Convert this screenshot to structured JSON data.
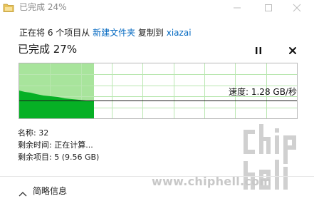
{
  "window": {
    "title": "已完成 24%"
  },
  "header": {
    "prefix": "正在将 6 个项目从 ",
    "source": "新建文件夹",
    "middle": " 复制到 ",
    "destination": "xiazai"
  },
  "progress": {
    "label": "已完成 27%",
    "fraction": 0.27
  },
  "graph": {
    "speed_label": "速度: 1.28 GB/秒"
  },
  "stats": {
    "name": "名称: 32",
    "time_remaining": "剩余时间: 正在计算...",
    "items_remaining": "剩余项目: 5 (9.56 GB)"
  },
  "footer": {
    "details_label": "简略信息"
  },
  "watermark": {
    "url": "www.chiphell.com",
    "logo_text": "chip hell"
  },
  "colors": {
    "accent": "#0067c0",
    "graph_fill": "#06b025",
    "graph_light": "#a8e49c",
    "grid": "#b9e7b0"
  },
  "icons": {
    "app": "folder-copy-icon",
    "pause": "pause-icon",
    "stop": "close-icon",
    "details": "chevron-up-icon"
  }
}
